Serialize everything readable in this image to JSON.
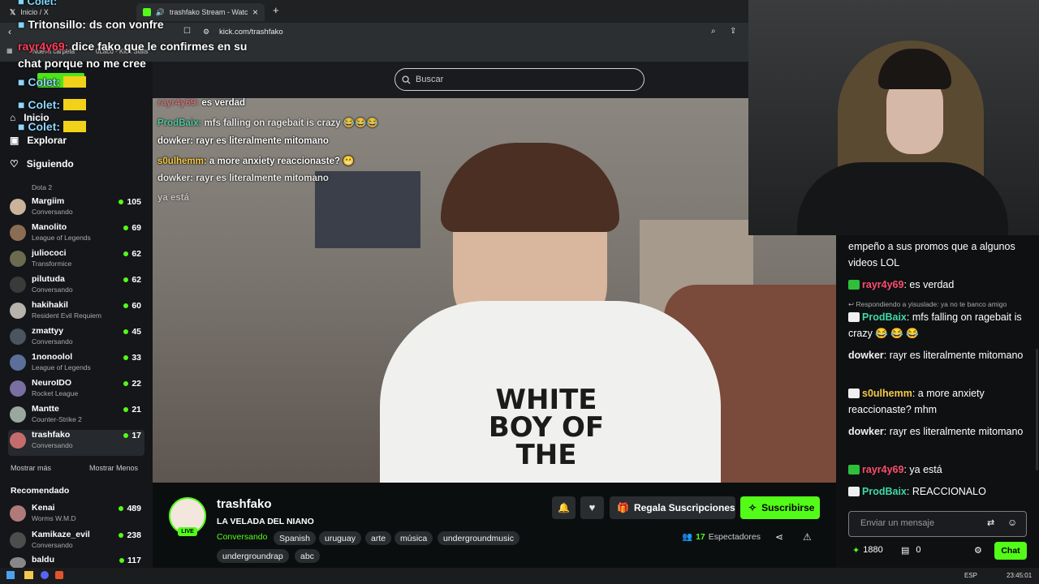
{
  "browser": {
    "tabs": [
      {
        "label": "Inicio / X"
      },
      {
        "label": "trashfako Stream - Watch Live"
      }
    ],
    "new_tab_symbol": "+",
    "tab_close_symbol": "×",
    "url": "kick.com/trashfako",
    "bookmarks": [
      "Nueva carpeta",
      "0Laco - Kick Stats"
    ]
  },
  "obs_overlay": {
    "lines": [
      {
        "user": "Colet:",
        "text": ""
      },
      {
        "user": "Tritonsillo:",
        "text": "ds con vonfre"
      },
      {
        "user": "rayr4y69:",
        "text": "dice fako que le confirmes en su chat porque no me cree"
      },
      {
        "user": "Colet:",
        "text": ""
      },
      {
        "user": "Colet:",
        "text": ""
      },
      {
        "user": "Colet:",
        "text": ""
      }
    ]
  },
  "search": {
    "placeholder": "Buscar"
  },
  "sidebar": {
    "nav": [
      {
        "label": "Inicio",
        "icon": "home-icon"
      },
      {
        "label": "Explorar",
        "icon": "compass-icon"
      },
      {
        "label": "Siguiendo",
        "icon": "heart-icon"
      }
    ],
    "top_category": "Dota 2",
    "following": [
      {
        "name": "Margiim",
        "category": "Conversando",
        "viewers": "105"
      },
      {
        "name": "Manolito",
        "category": "League of Legends",
        "viewers": "69"
      },
      {
        "name": "juliococi",
        "category": "Transformice",
        "viewers": "62"
      },
      {
        "name": "pilutuda",
        "category": "Conversando",
        "viewers": "62"
      },
      {
        "name": "hakihakil",
        "category": "Resident Evil Requiem",
        "viewers": "60"
      },
      {
        "name": "zmattyy",
        "category": "Conversando",
        "viewers": "45"
      },
      {
        "name": "1nonoolol",
        "category": "League of Legends",
        "viewers": "33"
      },
      {
        "name": "NeuroIDO",
        "category": "Rocket League",
        "viewers": "22"
      },
      {
        "name": "Mantte",
        "category": "Counter-Strike 2",
        "viewers": "21"
      },
      {
        "name": "trashfako",
        "category": "Conversando",
        "viewers": "17"
      }
    ],
    "show_more": "Mostrar más",
    "show_less": "Mostrar Menos",
    "recommended_title": "Recomendado",
    "recommended": [
      {
        "name": "Kenai",
        "category": "Worms W.M.D",
        "viewers": "489"
      },
      {
        "name": "Kamikaze_evil",
        "category": "Conversando",
        "viewers": "238"
      },
      {
        "name": "baldu",
        "category": "",
        "viewers": "117"
      }
    ]
  },
  "video_overlay_chat": [
    {
      "user": "rayr4y69:",
      "text": "es verdad"
    },
    {
      "user": "ProdBaix:",
      "text": "mfs falling on ragebait is crazy 😂😂😂"
    },
    {
      "user": "dowker:",
      "text": "rayr es literalmente mitomano"
    },
    {
      "user": "s0ulhemm:",
      "text": "a more anxiety reaccionaste? 😬"
    },
    {
      "user": "dowker:",
      "text": "rayr es literalmente mitomano"
    },
    {
      "user": "",
      "text": "ya está"
    }
  ],
  "video_shirt_text": "WHITE BOY OF THE",
  "stream": {
    "channel": "trashfako",
    "title": "LA VELADA DEL NIANO",
    "live_badge": "LIVE",
    "category": "Conversando",
    "tags": [
      "Spanish",
      "uruguay",
      "arte",
      "música",
      "undergroundmusic",
      "undergroundrap",
      "abc"
    ],
    "gift_label": "Regala Suscripciones",
    "subscribe_label": "Suscribirse",
    "viewers": "17",
    "viewers_label": "Espectadores"
  },
  "chat": {
    "messages": [
      {
        "user": "",
        "user_color": "#ffffff",
        "text": "empeño a sus promos que a algunos videos LOL",
        "badge": ""
      },
      {
        "user": "rayr4y69",
        "user_color": "#ff4d6d",
        "text": "es verdad",
        "badge": "sub"
      },
      {
        "reply_to": "Respondiendo a yisuslade: ya no te banco amigo"
      },
      {
        "user": "ProdBaix",
        "user_color": "#3fd9a5",
        "text": "mfs falling on ragebait is crazy 😂 😂 😂",
        "badge": "abc"
      },
      {
        "user": "dowker",
        "user_color": "#f0f0f0",
        "text": "rayr es literalmente mitomano",
        "badge": ""
      },
      {
        "user": "s0ulhemm",
        "user_color": "#f7c948",
        "text": "a more anxiety reaccionaste? mhm",
        "badge": "abc"
      },
      {
        "user": "dowker",
        "user_color": "#f0f0f0",
        "text": "rayr es literalmente mitomano",
        "badge": ""
      },
      {
        "user": "rayr4y69",
        "user_color": "#ff4d6d",
        "text": "ya está",
        "badge": "sub"
      },
      {
        "user": "ProdBaix",
        "user_color": "#3fd9a5",
        "text": "REACCIONALO",
        "badge": "abc"
      }
    ],
    "input_placeholder": "Enviar un mensaje",
    "points": "1880",
    "other_count": "0",
    "send_label": "Chat"
  },
  "taskbar": {
    "lang": "ESP",
    "time": "23:45:01"
  },
  "colors": {
    "kick_green": "#53fc18",
    "background": "#0b0e0f"
  }
}
